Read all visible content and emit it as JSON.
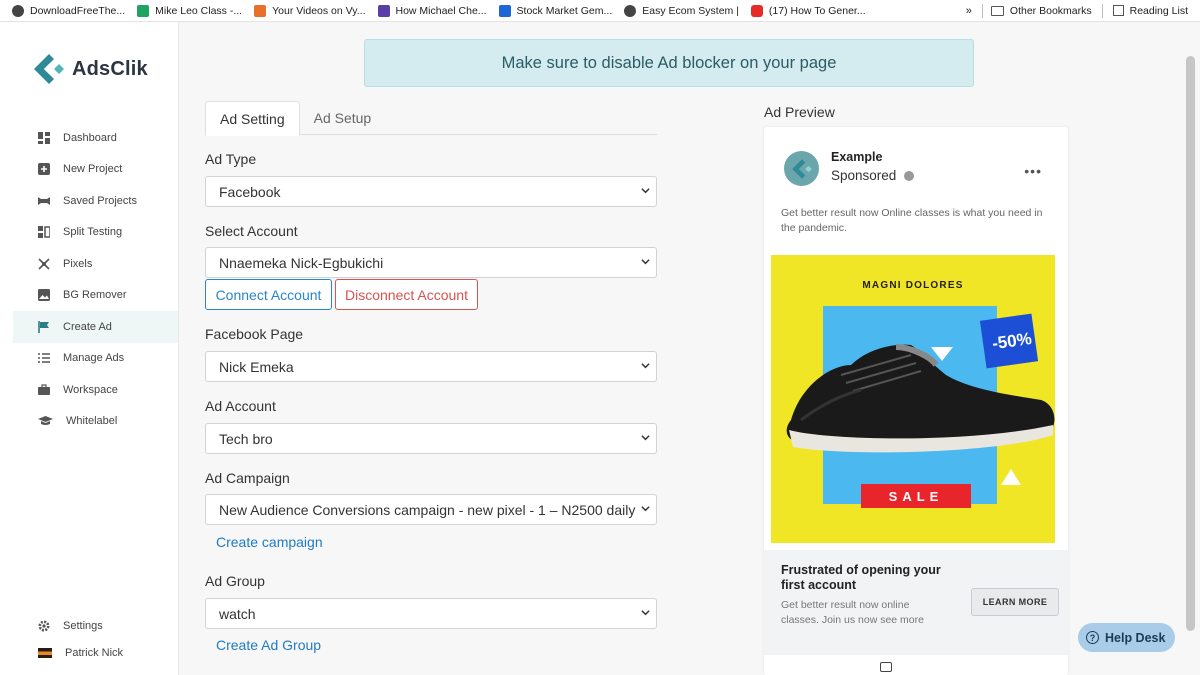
{
  "bookmarks": [
    {
      "label": "DownloadFreeThe...",
      "icon": "globe-icon",
      "color": "#444444"
    },
    {
      "label": "Mike Leo Class -...",
      "icon": "google-drive-icon",
      "color": "#1ea362"
    },
    {
      "label": "Your Videos on Vy...",
      "icon": "vyond-icon",
      "color": "#e8702a"
    },
    {
      "label": "How Michael Che...",
      "icon": "udemy-icon",
      "color": "#5a3ea8"
    },
    {
      "label": "Stock Market Gem...",
      "icon": "dropbox-icon",
      "color": "#1f66d6"
    },
    {
      "label": "Easy Ecom System |",
      "icon": "globe-icon",
      "color": "#444444"
    },
    {
      "label": "(17) How To Gener...",
      "icon": "youtube-icon",
      "color": "#e52d27"
    }
  ],
  "bookmarks_overflow": "»",
  "other_bookmarks": "Other Bookmarks",
  "reading_list": "Reading List",
  "brand": {
    "name": "AdsClik",
    "color": "#2e8a96"
  },
  "nav": [
    {
      "label": "Dashboard",
      "icon": "dashboard-icon"
    },
    {
      "label": "New Project",
      "icon": "plus-square-icon"
    },
    {
      "label": "Saved Projects",
      "icon": "folder-icon"
    },
    {
      "label": "Split Testing",
      "icon": "split-icon"
    },
    {
      "label": "Pixels",
      "icon": "pixel-icon"
    },
    {
      "label": "BG Remover",
      "icon": "image-icon"
    },
    {
      "label": "Create Ad",
      "icon": "flag-icon",
      "active": true
    },
    {
      "label": "Manage Ads",
      "icon": "list-icon"
    },
    {
      "label": "Workspace",
      "icon": "briefcase-icon"
    },
    {
      "label": "Whitelabel",
      "icon": "graduation-cap-icon"
    }
  ],
  "settings_label": "Settings",
  "user_name": "Patrick Nick",
  "banner": "Make sure to disable Ad blocker on your page",
  "tabs": [
    "Ad Setting",
    "Ad Setup"
  ],
  "form": {
    "ad_type": {
      "label": "Ad Type",
      "value": "Facebook"
    },
    "account": {
      "label": "Select Account",
      "value": "Nnaemeka Nick-Egbukichi"
    },
    "connect_btn": "Connect Account",
    "disconnect_btn": "Disconnect Account",
    "page": {
      "label": "Facebook Page",
      "value": "Nick Emeka"
    },
    "ad_account": {
      "label": "Ad Account",
      "value": "Tech bro"
    },
    "campaign": {
      "label": "Ad Campaign",
      "value": "New Audience Conversions campaign - new pixel - 1 – N2500 daily"
    },
    "create_campaign": "Create campaign",
    "ad_group": {
      "label": "Ad Group",
      "value": "watch"
    },
    "create_ad_group": "Create Ad Group"
  },
  "preview": {
    "title": "Ad Preview",
    "page_name": "Example",
    "sponsored": "Sponsored",
    "primary_text": "Get better result now Online classes is what you need in the pandemic.",
    "image_brand": "MAGNI DOLORES",
    "image_discount": "-50%",
    "image_sale": "SALE",
    "headline": "Frustrated of opening your first account",
    "description": "Get better result now online classes. Join us now see more",
    "cta": "LEARN MORE"
  },
  "help_desk": "Help Desk",
  "colors": {
    "accent": "#2a85c9",
    "danger": "#d9534f",
    "banner_bg": "#d4ecf0",
    "ad_yellow": "#f1e626",
    "ad_blue": "#4bb8f0",
    "ad_red": "#e8252b"
  }
}
